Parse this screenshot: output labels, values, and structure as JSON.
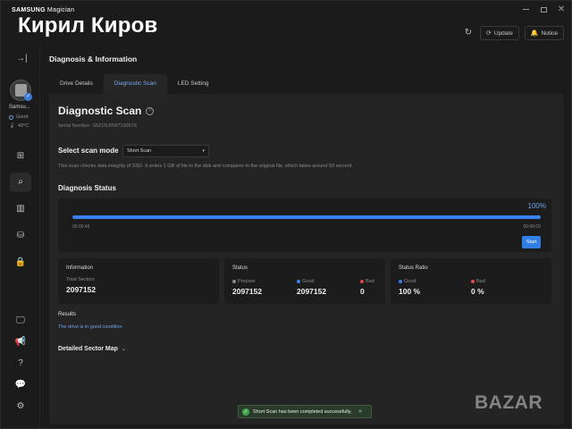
{
  "window": {
    "brand_bold": "SAMSUNG",
    "brand_rest": "Magician",
    "close_glyph": "✕"
  },
  "overlay": {
    "watermark_name": "Кирил Киров",
    "bazar_logo": "BAZAR"
  },
  "topbar": {
    "refresh_icon": "↻",
    "update_icon": "⟳",
    "update_label": "Update",
    "notice_icon": "🔔",
    "notice_label": "Notice"
  },
  "sidebar": {
    "collapse_icon": "→|",
    "drive_name": "Samsu...",
    "drive_status": "Good",
    "drive_temp": "43°C",
    "temp_icon": "🌡",
    "check_glyph": "✓",
    "nav": [
      {
        "name": "dashboard-icon",
        "glyph": "⊞"
      },
      {
        "name": "diagnosis-icon",
        "glyph": "⌕"
      },
      {
        "name": "performance-icon",
        "glyph": "▥"
      },
      {
        "name": "data-management-icon",
        "glyph": "⛁"
      },
      {
        "name": "security-icon",
        "glyph": "🔒"
      }
    ],
    "bottom_nav": [
      {
        "name": "monitor-icon",
        "glyph": "🖵"
      },
      {
        "name": "announcement-icon",
        "glyph": "📢"
      },
      {
        "name": "help-icon",
        "glyph": "?"
      },
      {
        "name": "feedback-icon",
        "glyph": "💬"
      },
      {
        "name": "settings-icon",
        "glyph": "⚙"
      }
    ]
  },
  "main": {
    "page_title": "Diagnosis & Information",
    "tabs": [
      {
        "label": "Drive Details",
        "active": false
      },
      {
        "label": "Diagnostic Scan",
        "active": true
      },
      {
        "label": "LED Setting",
        "active": false
      }
    ]
  },
  "scan": {
    "title": "Diagnostic Scan",
    "help_glyph": "?",
    "serial": "Serial Number: S6Z1NJ0W710057X",
    "mode_label": "Select scan mode",
    "mode_value": "Short Scan",
    "mode_caret": "▾",
    "description": "This scan checks data integrity of SSD. It writes 1 GB of file to the disk and compares to the original file, which takes around 53 second.",
    "status_heading": "Diagnosis Status",
    "progress": 1.0,
    "progress_label": "100%",
    "elapsed": "00:00:45",
    "remaining": "00:00:00",
    "start_label": "Start"
  },
  "cards": {
    "information": {
      "title": "Information",
      "total_sectors_label": "Total Sectors",
      "total_sectors": "2097152"
    },
    "status": {
      "title": "Status",
      "prepare_label": "Prepare",
      "prepare_value": "2097152",
      "good_label": "Good",
      "good_value": "2097152",
      "bad_label": "Bad",
      "bad_value": "0"
    },
    "ratio": {
      "title": "Status Ratio",
      "good_label": "Good",
      "good_value": "100 %",
      "bad_label": "Bad",
      "bad_value": "0 %"
    }
  },
  "results": {
    "label": "Results",
    "value": "The drive is in good condition",
    "sector_map_label": "Detailed Sector Map",
    "sector_map_chevron": "⌄"
  },
  "toast": {
    "check": "✓",
    "message": "Short Scan has been completed successfully.",
    "close": "✕"
  },
  "colors": {
    "accent": "#3b82f0",
    "link": "#6fa3f0",
    "good": "#3ea84a",
    "bad": "#e04848",
    "prepare": "#8a8a8a"
  }
}
